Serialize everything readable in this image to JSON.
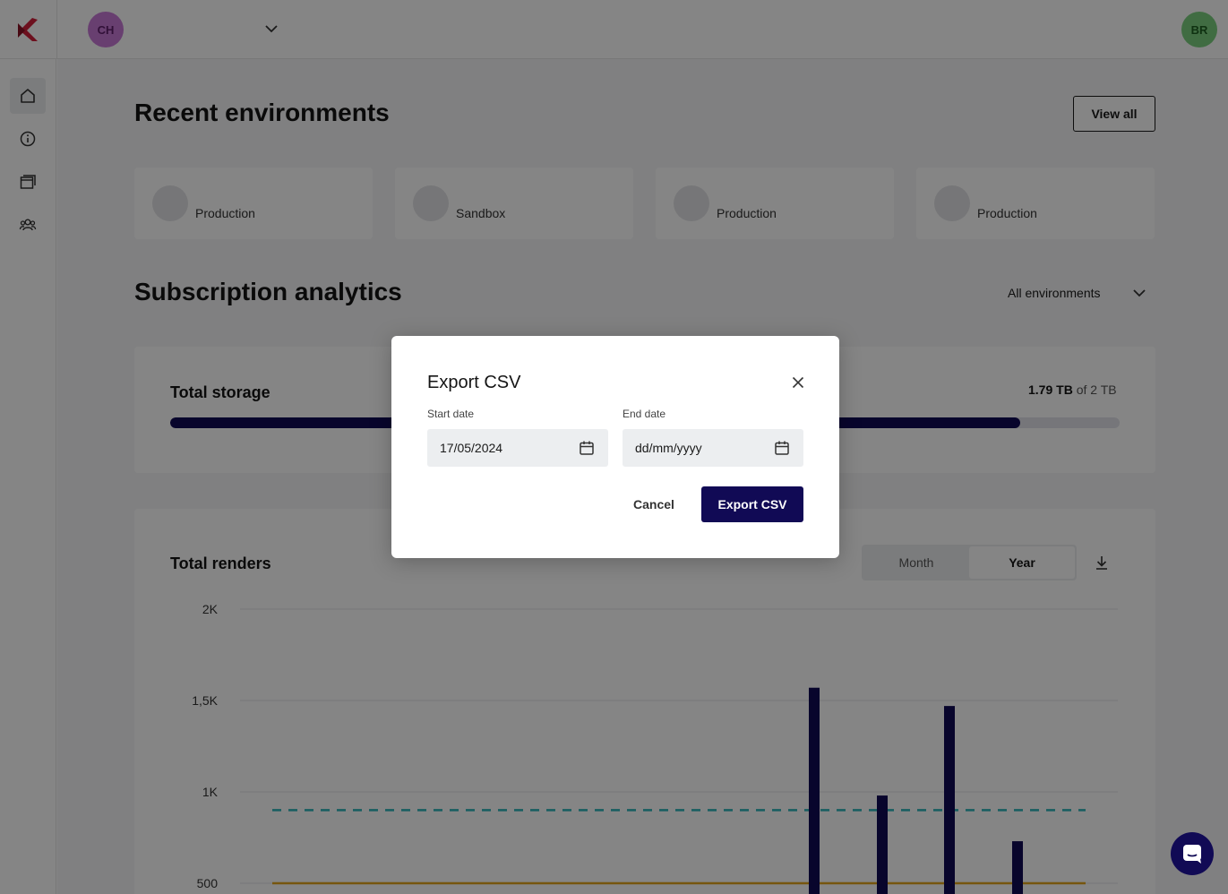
{
  "topbar": {
    "org_initials": "CH",
    "user_initials": "BR",
    "brand_color": "#d1203a"
  },
  "sidebar": {
    "items": [
      {
        "icon": "home-icon",
        "active": true
      },
      {
        "icon": "info-icon",
        "active": false
      },
      {
        "icon": "windows-icon",
        "active": false
      },
      {
        "icon": "users-icon",
        "active": false
      }
    ]
  },
  "recent": {
    "title": "Recent environments",
    "view_all_label": "View all",
    "environments": [
      {
        "name": "Production"
      },
      {
        "name": "Sandbox"
      },
      {
        "name": "Production"
      },
      {
        "name": "Production"
      }
    ]
  },
  "analytics": {
    "title": "Subscription analytics",
    "env_filter": "All environments",
    "storage": {
      "title": "Total storage",
      "used": "1.79 TB",
      "of_text": "of 2 TB",
      "fraction": 0.895
    },
    "renders": {
      "title": "Total renders",
      "toggle": {
        "month_label": "Month",
        "year_label": "Year",
        "selected": "Year"
      }
    }
  },
  "chart_data": {
    "type": "bar",
    "title": "Total renders",
    "y_ticks": [
      "2K",
      "1,5K",
      "1K",
      "500"
    ],
    "ylim": [
      500,
      2000
    ],
    "bars": [
      1570,
      980,
      1470,
      730
    ],
    "reference_lines": [
      {
        "value": 900,
        "style": "dashed",
        "color": "#2bb3b8"
      },
      {
        "value": 500,
        "style": "solid",
        "color": "#e3a51b"
      }
    ],
    "grid": true
  },
  "modal": {
    "title": "Export CSV",
    "start_label": "Start date",
    "start_value": "17/05/2024",
    "end_label": "End date",
    "end_placeholder": "dd/mm/yyyy",
    "cancel_label": "Cancel",
    "export_label": "Export CSV"
  },
  "colors": {
    "primary": "#110a55",
    "overlay": "rgba(0,0,0,0.48)"
  }
}
